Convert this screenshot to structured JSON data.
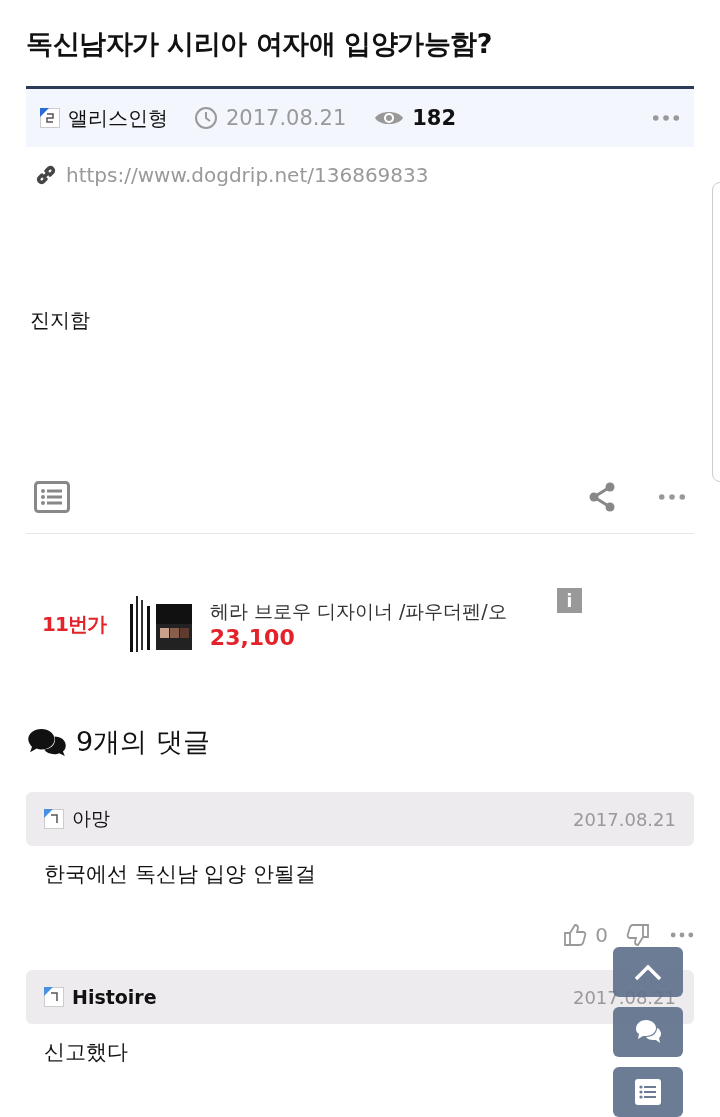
{
  "title": "독신남자가 시리아 여자애 입양가능함?",
  "post": {
    "author": "앨리스인형",
    "date": "2017.08.21",
    "views": "182",
    "url": "https://www.dogdrip.net/136869833",
    "body": "진지함"
  },
  "ad": {
    "shop": "11번가",
    "product": "헤라 브로우 디자이너 /파우더펜/오",
    "price": "23,100",
    "info": "i"
  },
  "comments_header": "9개의 댓글",
  "comments": [
    {
      "author": "아망",
      "bold": false,
      "date": "2017.08.21",
      "text": "한국에선 독신남 입양 안될걸",
      "likes": "0"
    },
    {
      "author": "Histoire",
      "bold": true,
      "date": "2017.08.21",
      "text": "신고했다"
    }
  ]
}
